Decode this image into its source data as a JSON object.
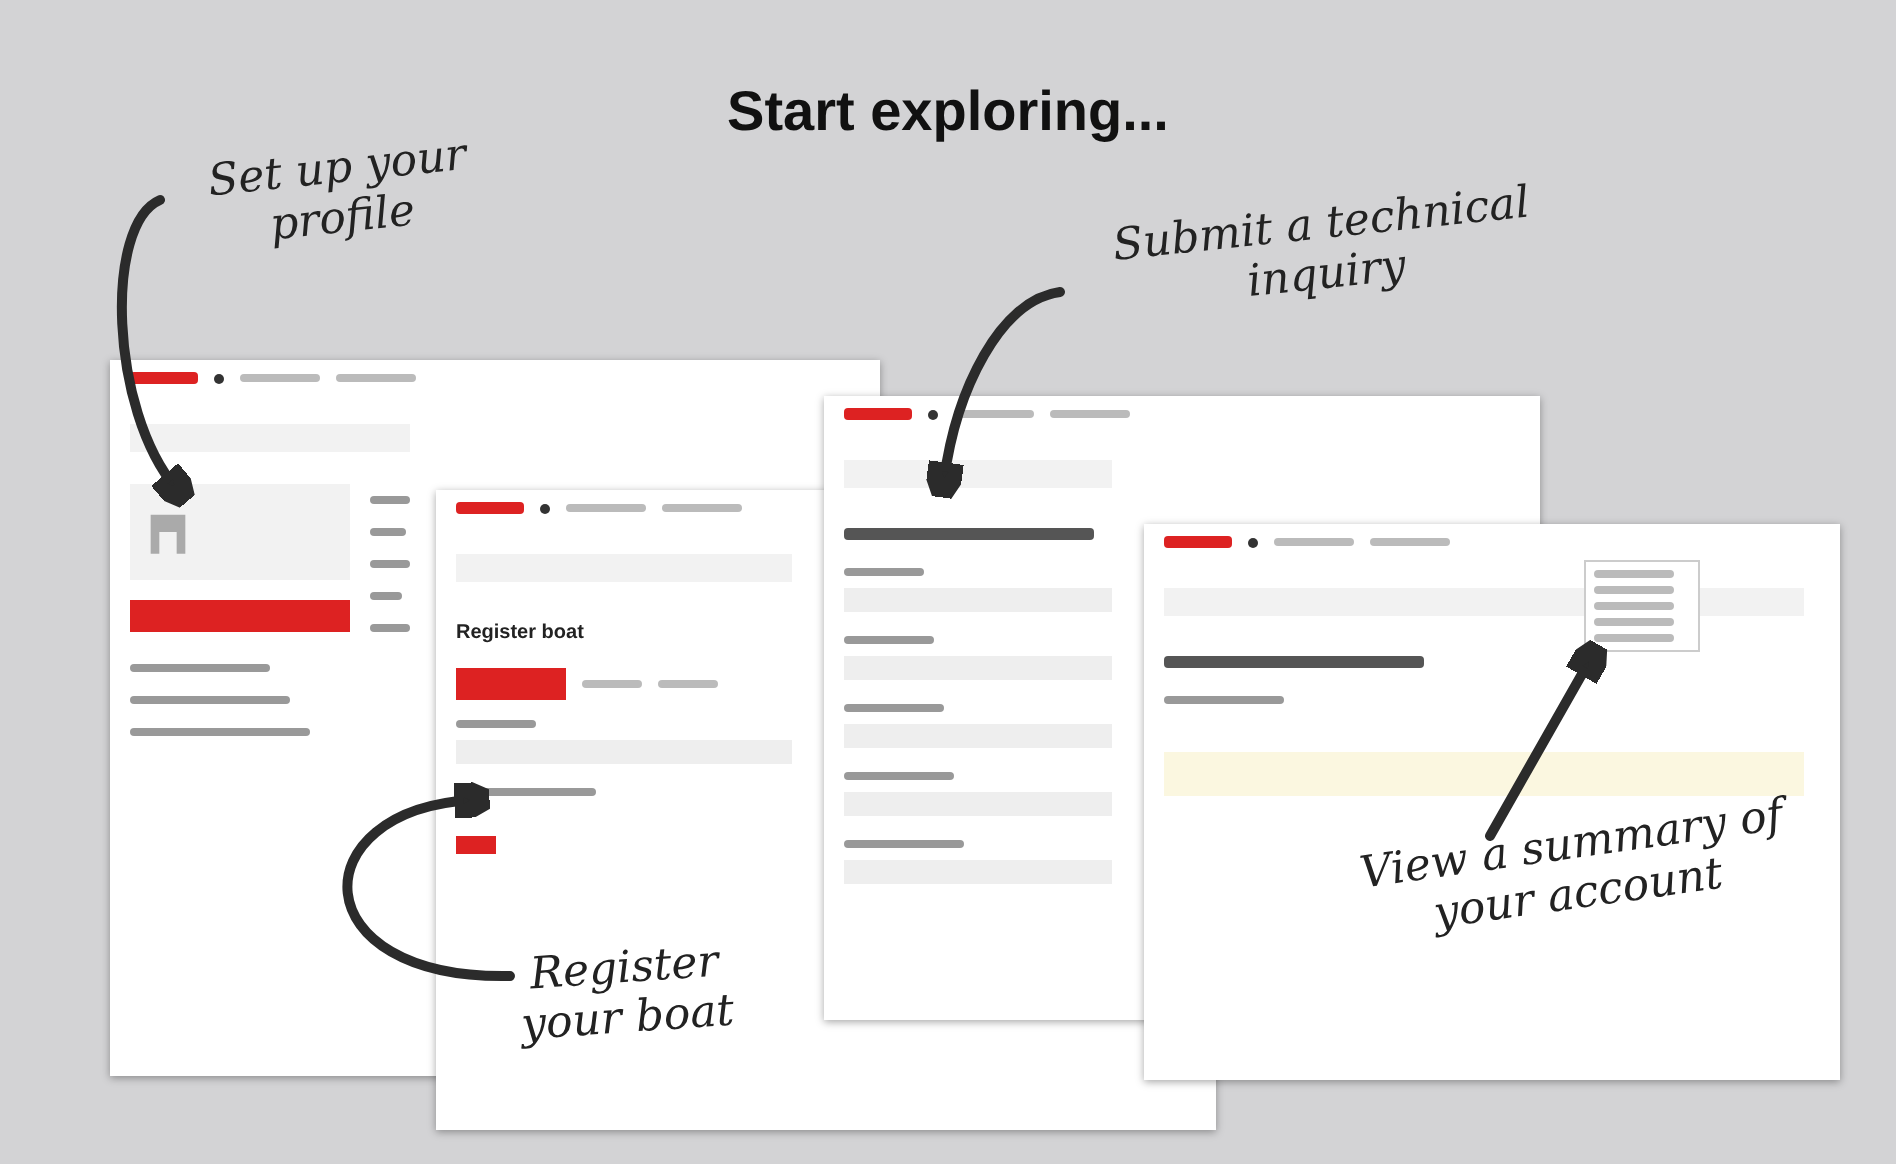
{
  "title": "Start exploring...",
  "screens": [
    {
      "kind": "profile",
      "menu": [
        {
          "selected": true
        },
        {
          "selected": false
        },
        {
          "selected": false
        },
        {
          "selected": false
        }
      ]
    },
    {
      "kind": "register",
      "heading": "Register boat",
      "steps": [
        {
          "selected": true
        },
        {
          "selected": false
        },
        {
          "selected": false
        }
      ]
    },
    {
      "kind": "request"
    },
    {
      "kind": "campaign"
    }
  ],
  "notes": [
    {
      "text": "Set up your profile"
    },
    {
      "text": "Submit a technical inquiry"
    },
    {
      "text": "Register your boat"
    },
    {
      "text": "View a summary of your account"
    }
  ]
}
